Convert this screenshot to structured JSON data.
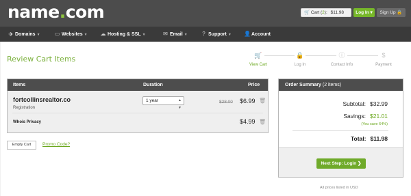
{
  "header": {
    "logo_main": "name",
    "logo_dot": ".",
    "logo_tld": "com",
    "cart": {
      "label": "Cart (",
      "count": "2",
      "close": "):",
      "total": "$11.98"
    },
    "login_label": "Log In ▾",
    "signup_label": "Sign Up 🔒"
  },
  "nav": {
    "items": [
      {
        "label": "Domains",
        "icon": "tag-icon"
      },
      {
        "label": "Websites",
        "icon": "monitor-icon"
      },
      {
        "label": "Hosting & SSL",
        "icon": "cloud-icon"
      },
      {
        "label": "Email",
        "icon": "envelope-icon"
      },
      {
        "label": "Support",
        "icon": "help-circle-icon"
      },
      {
        "label": "Account",
        "icon": "user-icon"
      }
    ]
  },
  "page": {
    "title": "Review Cart Items"
  },
  "steps": [
    {
      "label": "View Cart",
      "icon": "cart-icon",
      "active": true
    },
    {
      "label": "Log In",
      "icon": "lock-icon",
      "active": false
    },
    {
      "label": "Contact Info",
      "icon": "info-icon",
      "active": false
    },
    {
      "label": "Payment",
      "icon": "dollar-icon",
      "active": false
    }
  ],
  "cart_table": {
    "headers": {
      "items": "Items",
      "duration": "Duration",
      "price": "Price"
    },
    "rows": [
      {
        "name": "fortcollinsrealtor.co",
        "type": "Registration",
        "duration": "1 year",
        "old_price": "$28.00",
        "price": "$6.99"
      },
      {
        "name": "Whois Privacy",
        "price": "$4.99"
      }
    ]
  },
  "actions": {
    "empty_cart": "Empty Cart",
    "promo_code": "Promo Code?"
  },
  "summary": {
    "title": "Order Summary",
    "count": "(2 items)",
    "subtotal_label": "Subtotal:",
    "subtotal": "$32.99",
    "savings_label": "Savings:",
    "savings": "$21.01",
    "save_note": "(You save 64%)",
    "total_label": "Total:",
    "total": "$11.98",
    "next_button": "Next Step: Login ❯"
  },
  "footer_note": "All prices listed in USD",
  "colors": {
    "accent": "#7ab03b",
    "topbar": "#4c4c4c",
    "navbar": "#3a3a3a",
    "table_header": "#4d4d4d"
  }
}
